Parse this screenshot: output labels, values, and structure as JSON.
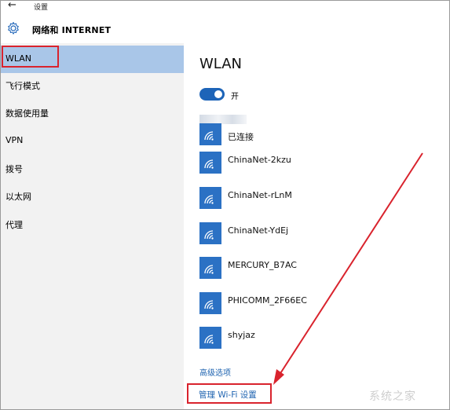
{
  "window": {
    "title": "设置",
    "back_icon": "back-arrow-icon"
  },
  "header": {
    "section_title": "网络和 INTERNET",
    "icon": "gear-icon"
  },
  "sidebar": {
    "items": [
      {
        "label": "WLAN",
        "active": true
      },
      {
        "label": "飞行模式"
      },
      {
        "label": "数据使用量"
      },
      {
        "label": "VPN"
      },
      {
        "label": "拨号"
      },
      {
        "label": "以太网"
      },
      {
        "label": "代理"
      }
    ]
  },
  "main": {
    "title": "WLAN",
    "toggle": {
      "state": "on",
      "label": "开"
    },
    "networks": [
      {
        "name": "已连接",
        "connected": true
      },
      {
        "name": "ChinaNet-2kzu"
      },
      {
        "name": "ChinaNet-rLnM"
      },
      {
        "name": "ChinaNet-YdEj"
      },
      {
        "name": "MERCURY_B7AC"
      },
      {
        "name": "PHICOMM_2F66EC"
      },
      {
        "name": "shyjaz"
      }
    ],
    "advanced_link": "高级选项",
    "manage_link": "管理 Wi-Fi 设置"
  },
  "watermark": "系统之家",
  "colors": {
    "accent": "#2b71c4",
    "selection": "#a9c6e8",
    "highlight_box": "#d9232d",
    "link": "#1e63b0"
  }
}
